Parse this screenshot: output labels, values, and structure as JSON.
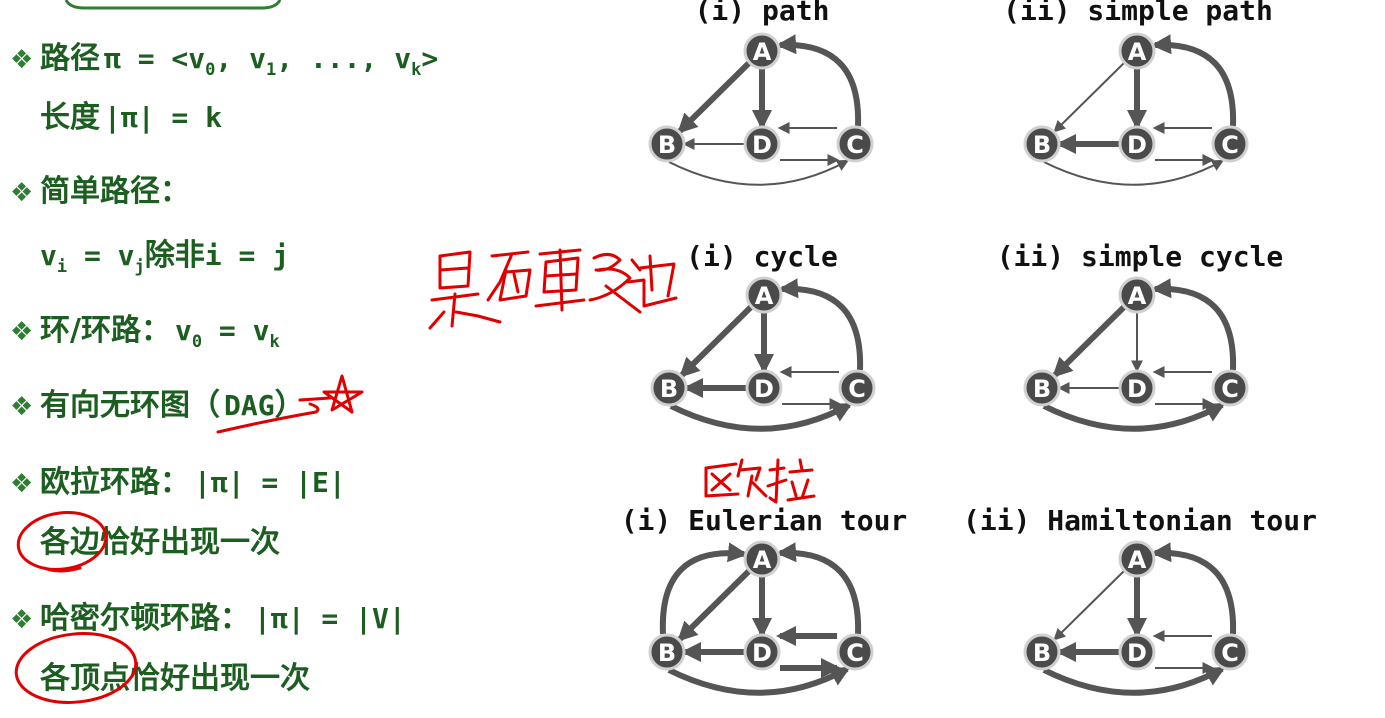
{
  "definitions": [
    {
      "id": "path",
      "bullet": "❖",
      "term": "路径",
      "math": [
        {
          "t": "π = <v"
        },
        {
          "t": "0",
          "sub": true
        },
        {
          "t": ", v"
        },
        {
          "t": "1",
          "sub": true
        },
        {
          "t": ", ..., v"
        },
        {
          "t": "k",
          "sub": true
        },
        {
          "t": ">"
        }
      ]
    },
    {
      "id": "length",
      "term": "长度",
      "math": [
        {
          "t": "|π| = k"
        }
      ]
    },
    {
      "id": "simple-path",
      "bullet": "❖",
      "term": "简单路径：",
      "math": []
    },
    {
      "id": "simple-cond",
      "term": "",
      "math": [
        {
          "t": "v"
        },
        {
          "t": "i",
          "sub": true
        },
        {
          "t": " = v"
        },
        {
          "t": "j",
          "sub": true
        },
        {
          "t": "除非",
          "cjk": true
        },
        {
          "t": "i = j"
        }
      ]
    },
    {
      "id": "cycle",
      "bullet": "❖",
      "term": "环/环路：",
      "math": [
        {
          "t": "v"
        },
        {
          "t": "0",
          "sub": true
        },
        {
          "t": " = v"
        },
        {
          "t": "k",
          "sub": true
        }
      ]
    },
    {
      "id": "dag",
      "bullet": "❖",
      "term": "有向无环图（",
      "math": [
        {
          "t": "DAG"
        },
        {
          "t": "）",
          "cjk": true
        }
      ]
    },
    {
      "id": "euler",
      "bullet": "❖",
      "term": "欧拉环路：",
      "math": [
        {
          "t": "|π| = |E|"
        }
      ]
    },
    {
      "id": "euler-desc",
      "term": "各边恰好出现一次",
      "math": []
    },
    {
      "id": "hamilton",
      "bullet": "❖",
      "term": "哈密尔顿环路：",
      "math": [
        {
          "t": "|π| = |V|"
        }
      ]
    },
    {
      "id": "hamilton-desc",
      "term": "各顶点恰好出现一次",
      "math": []
    }
  ],
  "node_labels": {
    "A": "A",
    "B": "B",
    "C": "C",
    "D": "D"
  },
  "graphs": [
    {
      "id": "path",
      "title": "(i) path",
      "bold": [
        "AB",
        "AD",
        "CA"
      ]
    },
    {
      "id": "simple-path",
      "title": "(ii) simple path",
      "bold": [
        "AD",
        "DB",
        "CA"
      ]
    },
    {
      "id": "cycle",
      "title": "(i) cycle",
      "bold": [
        "AB",
        "AD",
        "DB",
        "BC",
        "CA"
      ]
    },
    {
      "id": "simple-cycle",
      "title": "(ii) simple cycle",
      "bold": [
        "AB",
        "BC",
        "CA"
      ]
    },
    {
      "id": "eulerian-tour",
      "title": "(i) Eulerian tour",
      "bold": [
        "BA",
        "AB",
        "AD",
        "DB",
        "BC",
        "CD",
        "DC",
        "CA"
      ]
    },
    {
      "id": "hamiltonian-tour",
      "title": "(ii) Hamiltonian tour",
      "bold": [
        "AD",
        "DB",
        "BC",
        "CA"
      ]
    }
  ],
  "handwriting": {
    "line1": "是否重复边",
    "line2": "欧拉"
  },
  "colors": {
    "definition_text": "#1b5e20",
    "bullet": "#2e7d32",
    "node_fill": "#4a4a4a",
    "edge": "#555555",
    "ink": "#e00000"
  }
}
